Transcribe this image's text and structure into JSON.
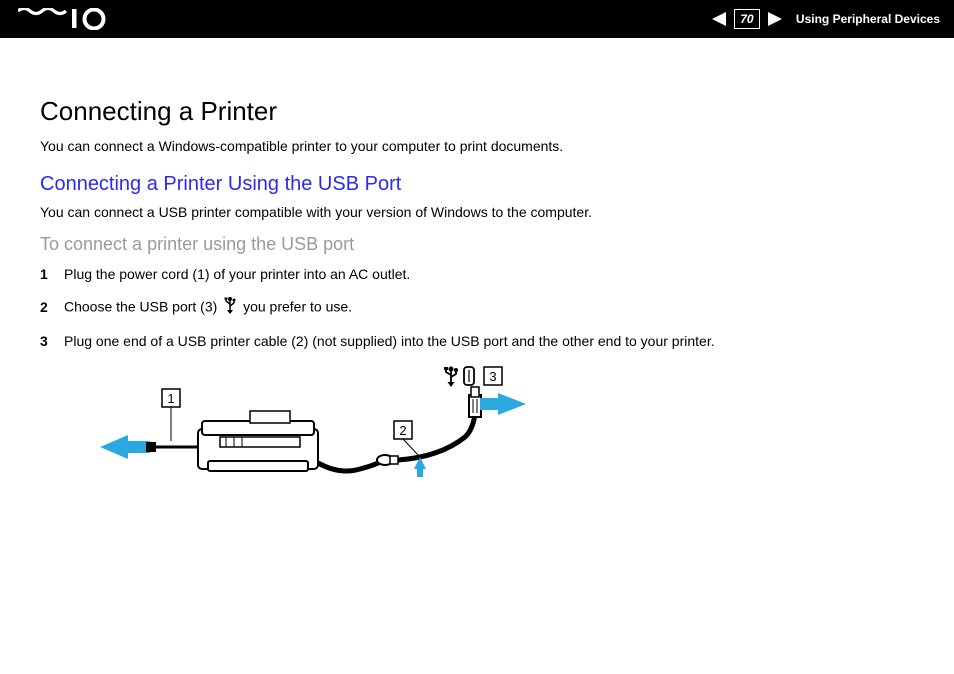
{
  "header": {
    "page_number": "70",
    "section": "Using Peripheral Devices"
  },
  "title": "Connecting a Printer",
  "intro": "You can connect a Windows-compatible printer to your computer to print documents.",
  "subtitle": "Connecting a Printer Using the USB Port",
  "subintro": "You can connect a USB printer compatible with your version of Windows to the computer.",
  "procedure_heading": "To connect a printer using the USB port",
  "steps": [
    {
      "num": "1",
      "text": "Plug the power cord (1) of your printer into an AC outlet."
    },
    {
      "num": "2",
      "text_before": "Choose the USB port (3) ",
      "text_after": " you prefer to use."
    },
    {
      "num": "3",
      "text": "Plug one end of a USB printer cable (2) (not supplied) into the USB port and the other end to your printer."
    }
  ],
  "figure_labels": {
    "l1": "1",
    "l2": "2",
    "l3": "3"
  }
}
